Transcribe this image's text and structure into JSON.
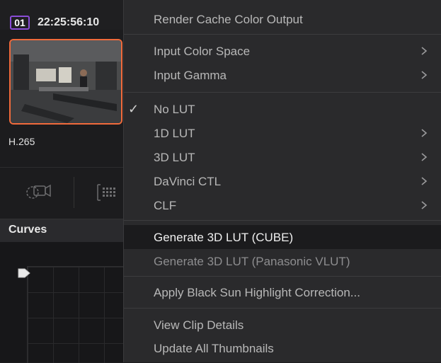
{
  "clip": {
    "number": "01",
    "timecode": "22:25:56:10",
    "codec": "H.265"
  },
  "panel": {
    "curves_label": "Curves"
  },
  "menu": {
    "items": [
      {
        "label": "Render Cache Color Output"
      },
      {
        "label": "Input Color Space",
        "submenu": true
      },
      {
        "label": "Input Gamma",
        "submenu": true
      },
      {
        "label": "No LUT",
        "checked": true
      },
      {
        "label": "1D LUT",
        "submenu": true
      },
      {
        "label": "3D LUT",
        "submenu": true
      },
      {
        "label": "DaVinci CTL",
        "submenu": true
      },
      {
        "label": "CLF",
        "submenu": true
      },
      {
        "label": "Generate 3D LUT (CUBE)",
        "highlighted": true
      },
      {
        "label": "Generate 3D LUT (Panasonic VLUT)"
      },
      {
        "label": "Apply Black Sun Highlight Correction..."
      },
      {
        "label": "View Clip Details"
      },
      {
        "label": "Update All Thumbnails"
      }
    ]
  },
  "icons": {
    "checkmark": "check-icon",
    "submenu_arrow": "chevron-right-icon",
    "node_tool": "camera-node-icon",
    "grid_tool": "grid-icon",
    "curve_point": "curve-handle-icon"
  },
  "colors": {
    "clip_badge_border": "#8a4dd6",
    "thumbnail_selected_border": "#f06a3b",
    "menu_background": "#2a2a2c",
    "menu_highlight": "#1b1b1d"
  }
}
